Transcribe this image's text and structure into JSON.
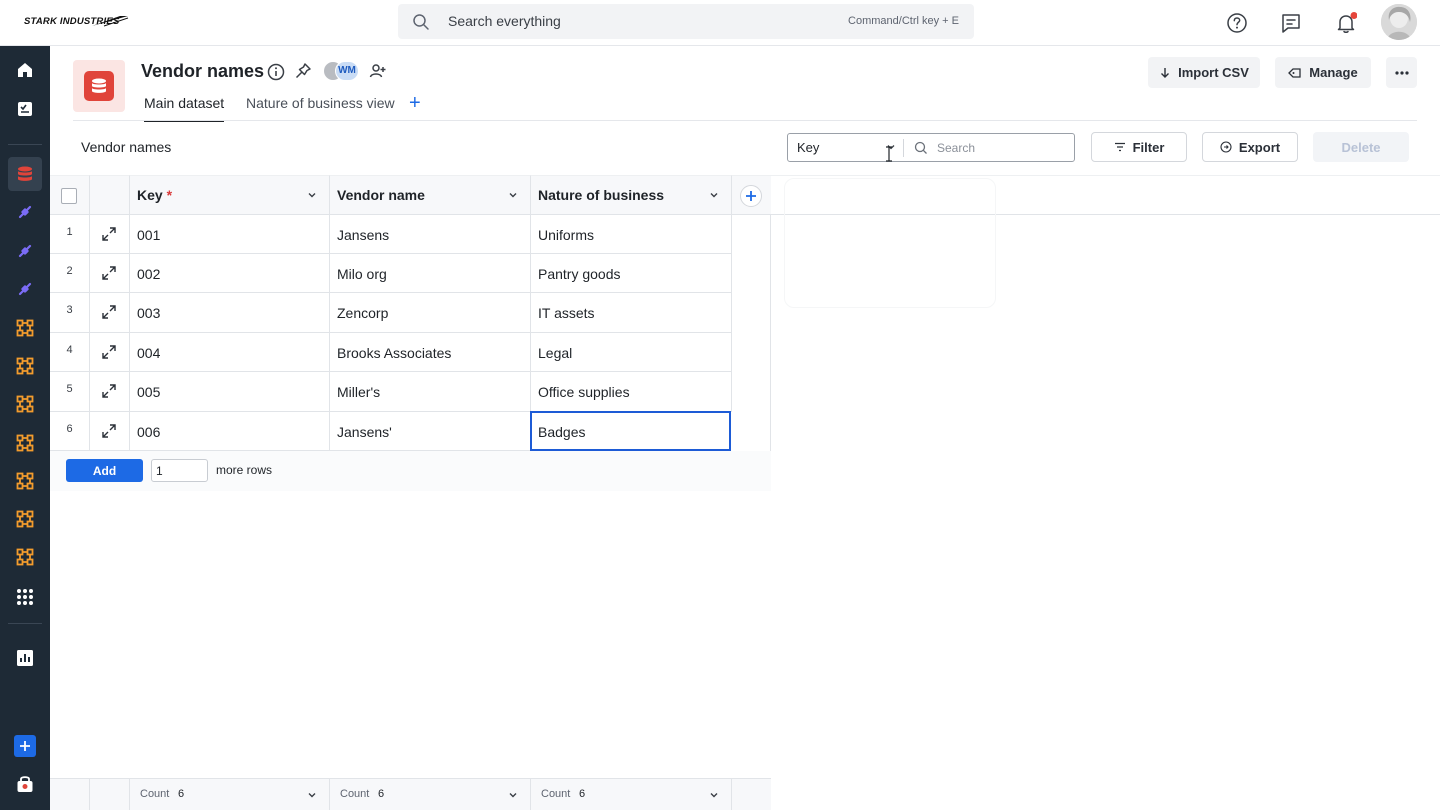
{
  "brand": {
    "name": "STARK INDUSTRIES"
  },
  "search": {
    "placeholder": "Search everything",
    "shortcut": "Command/Ctrl key + E"
  },
  "topbar_icons": [
    "help-icon",
    "feedback-icon",
    "bell-icon"
  ],
  "notification_dot_color": "#e5453b",
  "rail": {
    "items": [
      "home-icon",
      "tasks-icon",
      "database-icon",
      "link-icon",
      "link-icon",
      "link-icon",
      "workflow-icon",
      "workflow-icon",
      "workflow-icon",
      "workflow-icon",
      "workflow-icon",
      "workflow-icon",
      "workflow-icon",
      "apps-grid-icon",
      "analytics-icon",
      "add-icon",
      "store-icon"
    ],
    "active": "database-icon"
  },
  "header": {
    "title": "Vendor names",
    "collaborator_initials": "WM",
    "tabs": [
      {
        "label": "Main dataset",
        "active": true
      },
      {
        "label": "Nature of business view",
        "active": false
      }
    ],
    "actions": {
      "import_csv": "Import CSV",
      "manage": "Manage"
    }
  },
  "toolbar": {
    "section_title": "Vendor names",
    "search_field": "Key",
    "search_placeholder": "Search",
    "filter": "Filter",
    "export": "Export",
    "delete": "Delete"
  },
  "table": {
    "columns": [
      {
        "label": "Key",
        "required": "*"
      },
      {
        "label": "Vendor name",
        "required": ""
      },
      {
        "label": "Nature of business",
        "required": ""
      }
    ],
    "rows": [
      {
        "num": "1",
        "key": "001",
        "vendor": "Jansens",
        "nature": "Uniforms"
      },
      {
        "num": "2",
        "key": "002",
        "vendor": "Milo org",
        "nature": "Pantry goods"
      },
      {
        "num": "3",
        "key": "003",
        "vendor": "Zencorp",
        "nature": "IT assets"
      },
      {
        "num": "4",
        "key": "004",
        "vendor": "Brooks Associates",
        "nature": "Legal"
      },
      {
        "num": "5",
        "key": "005",
        "vendor": "Miller's",
        "nature": "Office supplies"
      },
      {
        "num": "6",
        "key": "006",
        "vendor": "Jansens'",
        "nature": "Badges"
      }
    ],
    "selected_cell": {
      "row": 6,
      "column": "Nature of business"
    },
    "add_rows": {
      "button": "Add",
      "count": "1",
      "suffix": "more rows"
    },
    "footer": [
      {
        "label": "Count",
        "value": "6"
      },
      {
        "label": "Count",
        "value": "6"
      },
      {
        "label": "Count",
        "value": "6"
      }
    ]
  },
  "colors": {
    "primary": "#1d6ae5",
    "dataset_icon": "#e0443a",
    "rail": "#1e2a36",
    "rail_accent": "#7b6cf6",
    "workflow": "#f39c2d"
  }
}
